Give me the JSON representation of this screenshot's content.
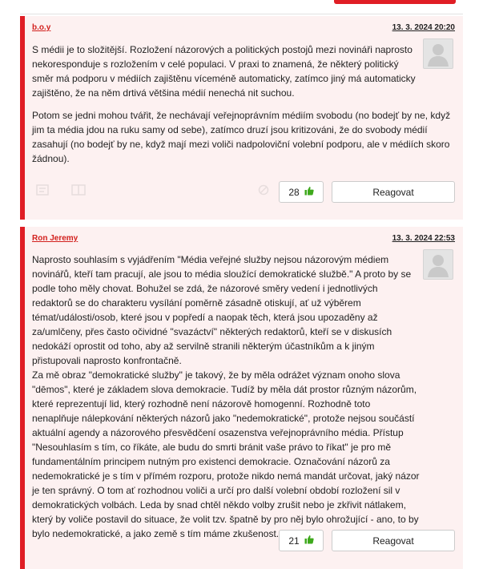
{
  "comments": [
    {
      "author": "b.o.y",
      "date": "13. 3. 2024 20:20",
      "paragraphs": [
        "S médii je to složitější. Rozložení názorových a politických postojů mezi novináři naprosto nekoresponduje s rozložením v celé populaci. V praxi to znamená, že některý politický směr má podporu v médiích zajištěnu víceméně automaticky, zatímco jiný má automaticky zajištěno, že na něm drtivá většina médií nenechá nit suchou.",
        "Potom se jedni mohou tvářit, že nechávají veřejnoprávním médiím svobodu (no bodejť by ne, když jim ta média jdou na ruku samy od sebe), zatímco druzí jsou kritizováni, že do svobody médií zasahují (no bodejť by ne, když mají mezi voliči nadpoloviční volební podporu, ale v médiích skoro žádnou)."
      ],
      "likes": "28",
      "reply_label": "Reagovat"
    },
    {
      "author": "Ron Jeremy",
      "date": "13. 3. 2024 22:53",
      "paragraphs": [
        "Naprosto souhlasím s vyjádřením \"Média veřejné služby nejsou názorovým médiem novinářů, kteří tam pracují, ale jsou to média sloužící demokratické službě.\" A proto by se podle toho měly chovat. Bohužel se zdá, že názorové směry vedení i jednotlivých redaktorů se do charakteru vysílání poměrně zásadně otiskují, ať už výběrem témat/události/osob, které jsou v popředí a naopak těch, která jsou upozaděny až za/umlčeny, přes často očividné \"svazáctví\" některých redaktorů, kteří se v diskusích nedokáží oprostit od toho, aby až servilně stranili některým účastníkům a k jiným přistupovali naprosto konfrontačně.",
        "Za mě obraz \"demokratické služby\" je takový, že by měla odrážet význam onoho slova \"dēmos\", které je základem slova demokracie. Tudíž by měla dát prostor různým názorům, které reprezentují lid, který rozhodně není názorově homogenní. Rozhodně toto nenaplňuje nálepkování některých názorů jako \"nedemokratické\", protože nejsou součástí aktuální agendy a názorového přesvědčení osazenstva veřejnoprávního média. Přístup \"Nesouhlasím s tím, co říkáte, ale budu do smrti bránit vaše právo to říkat\" je pro mě fundamentálním principem nutným pro existenci demokracie. Označování názorů za nedemokratické je s tím v přímém rozporu, protože nikdo nemá mandát určovat, jaký názor je ten správný. O tom ať rozhodnou voliči a určí pro další volební období rozložení sil v demokratických volbách. Leda by snad chtěl někdo volby zrušit nebo je zkřivit nátlakem, který by voliče postavil do situace, že volit tzv. špatně by pro něj bylo ohrožující - ano, to by bylo nedemokratické, a jako země s tím máme zkušenost."
      ],
      "likes": "21",
      "reply_label": "Reagovat"
    }
  ]
}
